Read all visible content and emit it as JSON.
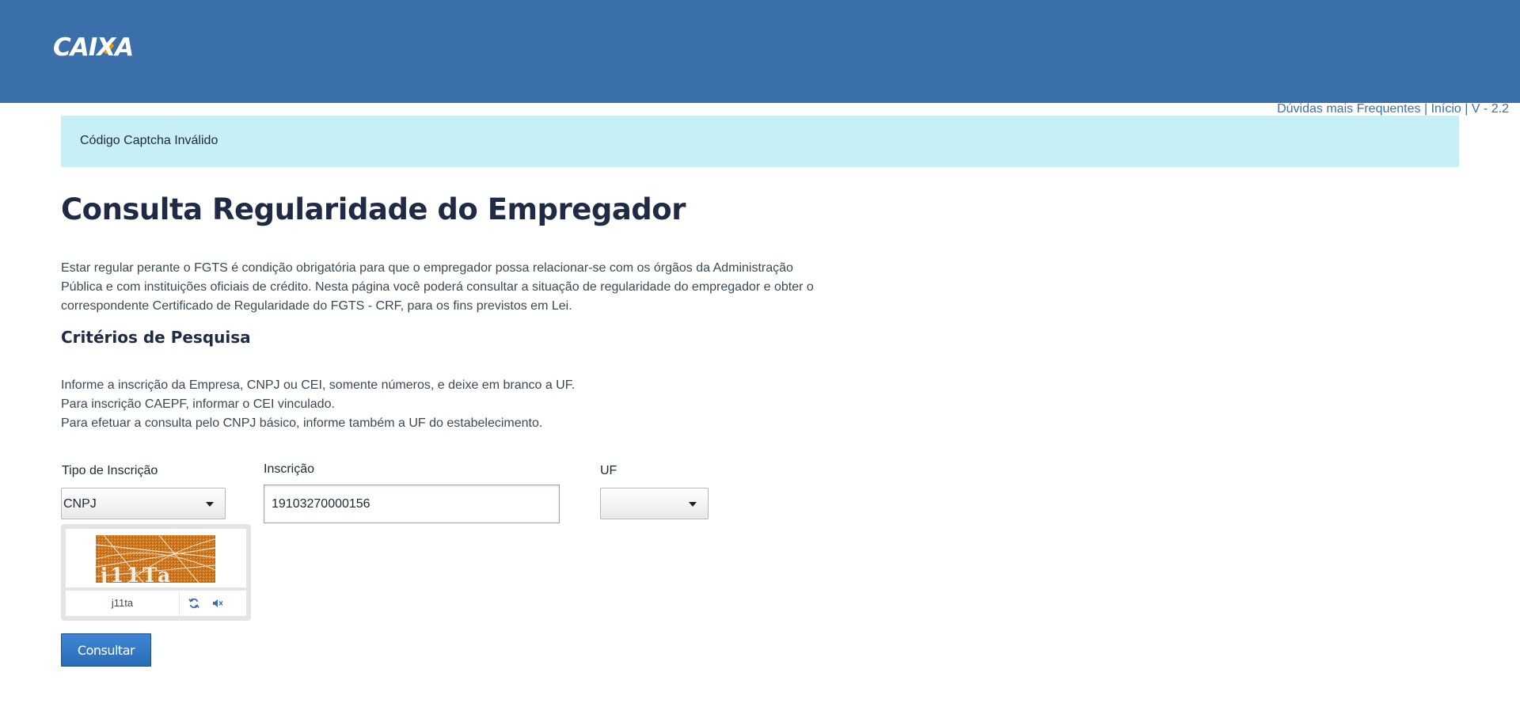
{
  "header": {
    "logo_text_a": "CAI",
    "logo_text_x": "X",
    "logo_text_b": "A",
    "links": {
      "faq": "Dúvidas mais Frequentes",
      "separator": " | ",
      "home": "Início",
      "version": "V - 2.2"
    }
  },
  "alert": {
    "message": "Código Captcha Inválido"
  },
  "page": {
    "title": "Consulta Regularidade do Empregador",
    "intro": "Estar regular perante o FGTS é condição obrigatória para que o empregador possa relacionar-se com os órgãos da Administração Pública e com instituições oficiais de crédito. Nesta página você poderá consultar a situação de regularidade do empregador e obter o correspondente Certificado de Regularidade do FGTS - CRF, para os fins previstos em Lei.",
    "criteria_title": "Critérios de Pesquisa",
    "instructions": [
      "Informe a inscrição da Empresa, CNPJ ou CEI, somente números, e deixe em branco a UF.",
      "Para inscrição CAEPF, informar o CEI vinculado.",
      "Para efetuar a consulta pelo CNPJ básico, informe também a UF do estabelecimento."
    ]
  },
  "form": {
    "tipo_label": "Tipo de Inscrição",
    "tipo_value": "CNPJ",
    "inscricao_label": "Inscrição",
    "inscricao_value": "19103270000156",
    "uf_label": "UF",
    "uf_value": "",
    "captcha_image_text": "j11Ta",
    "captcha_input_value": "j11ta",
    "submit_label": "Consultar"
  },
  "colors": {
    "header_bg": "#3b6faa",
    "alert_bg": "#c7eff6",
    "title": "#1f2a44",
    "button": "#2f74c3",
    "captcha_bg": "#c8741f"
  },
  "icons": {
    "refresh": "refresh-icon",
    "audio": "audio-icon"
  }
}
